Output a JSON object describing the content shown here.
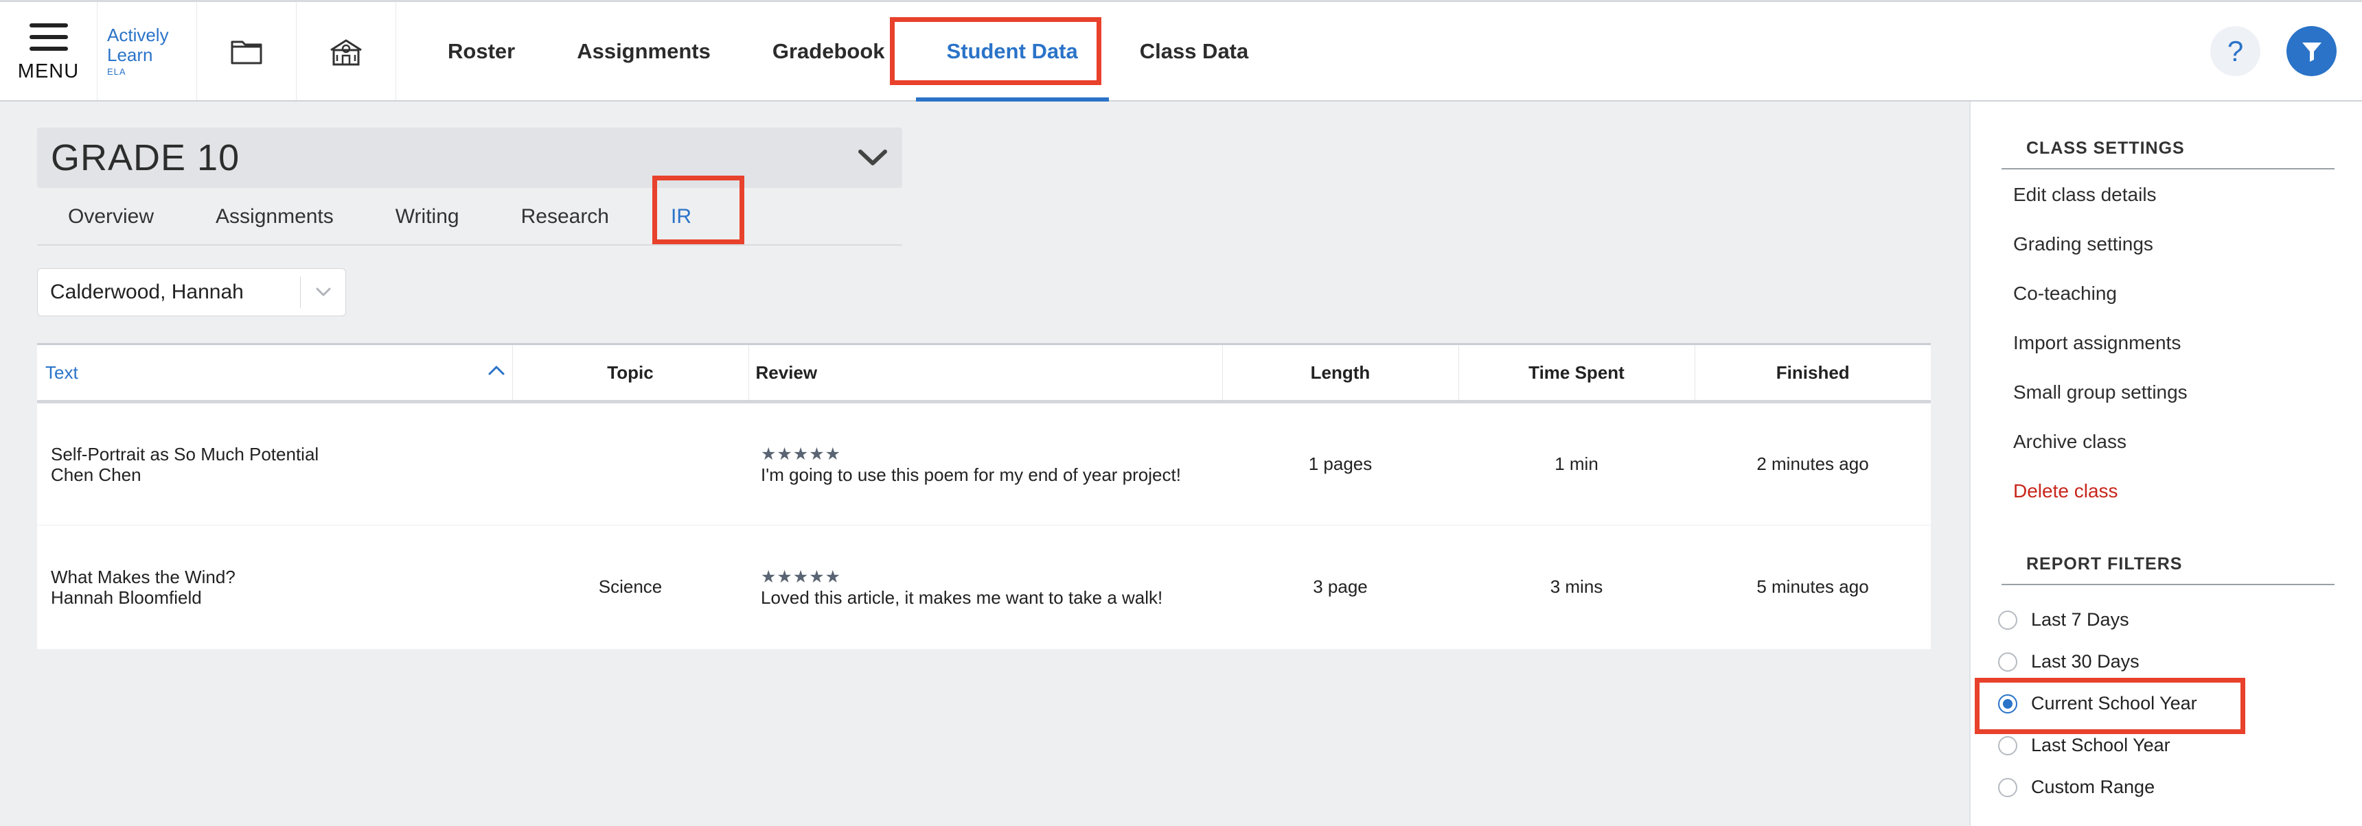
{
  "topbar": {
    "menu_label": "MENU",
    "logo": {
      "line1": "Actively",
      "line2": "Learn",
      "sub": "ELA"
    },
    "nav_tabs": [
      {
        "label": "Roster",
        "active": false
      },
      {
        "label": "Assignments",
        "active": false
      },
      {
        "label": "Gradebook",
        "active": false
      },
      {
        "label": "Student Data",
        "active": true
      },
      {
        "label": "Class Data",
        "active": false
      }
    ],
    "help_label": "?",
    "icons": {
      "library": "folder-icon",
      "school": "school-icon",
      "filter": "filter-icon"
    }
  },
  "main": {
    "grade_title": "GRADE 10",
    "subtabs": [
      {
        "label": "Overview",
        "active": false
      },
      {
        "label": "Assignments",
        "active": false
      },
      {
        "label": "Writing",
        "active": false
      },
      {
        "label": "Research",
        "active": false
      },
      {
        "label": "IR",
        "active": true
      }
    ],
    "student_select": "Calderwood, Hannah",
    "table": {
      "headers": {
        "text": "Text",
        "topic": "Topic",
        "review": "Review",
        "length": "Length",
        "time_spent": "Time Spent",
        "finished": "Finished"
      },
      "rows": [
        {
          "title": "Self-Portrait as So Much Potential",
          "author": "Chen Chen",
          "topic": "",
          "stars": "★★★★★",
          "review": "I'm going to use this poem for my end of year project!",
          "length": "1 pages",
          "time_spent": "1 min",
          "finished": "2 minutes ago"
        },
        {
          "title": "What Makes the Wind?",
          "author": "Hannah Bloomfield",
          "topic": "Science",
          "stars": "★★★★★",
          "review": "Loved this article, it makes me want to take a walk!",
          "length": "3 page",
          "time_spent": "3 mins",
          "finished": "5 minutes ago"
        }
      ]
    }
  },
  "sidebar": {
    "class_settings_heading": "CLASS SETTINGS",
    "class_settings": [
      "Edit class details",
      "Grading settings",
      "Co-teaching",
      "Import assignments",
      "Small group settings",
      "Archive class",
      "Delete class"
    ],
    "report_filters_heading": "REPORT FILTERS",
    "report_filters": [
      {
        "label": "Last 7 Days",
        "checked": false
      },
      {
        "label": "Last 30 Days",
        "checked": false
      },
      {
        "label": "Current School Year",
        "checked": true
      },
      {
        "label": "Last School Year",
        "checked": false
      },
      {
        "label": "Custom Range",
        "checked": false
      }
    ]
  },
  "colors": {
    "accent": "#2a73c8",
    "highlight": "#e8412c",
    "danger": "#c8261b",
    "main_bg": "#eeeff1"
  }
}
